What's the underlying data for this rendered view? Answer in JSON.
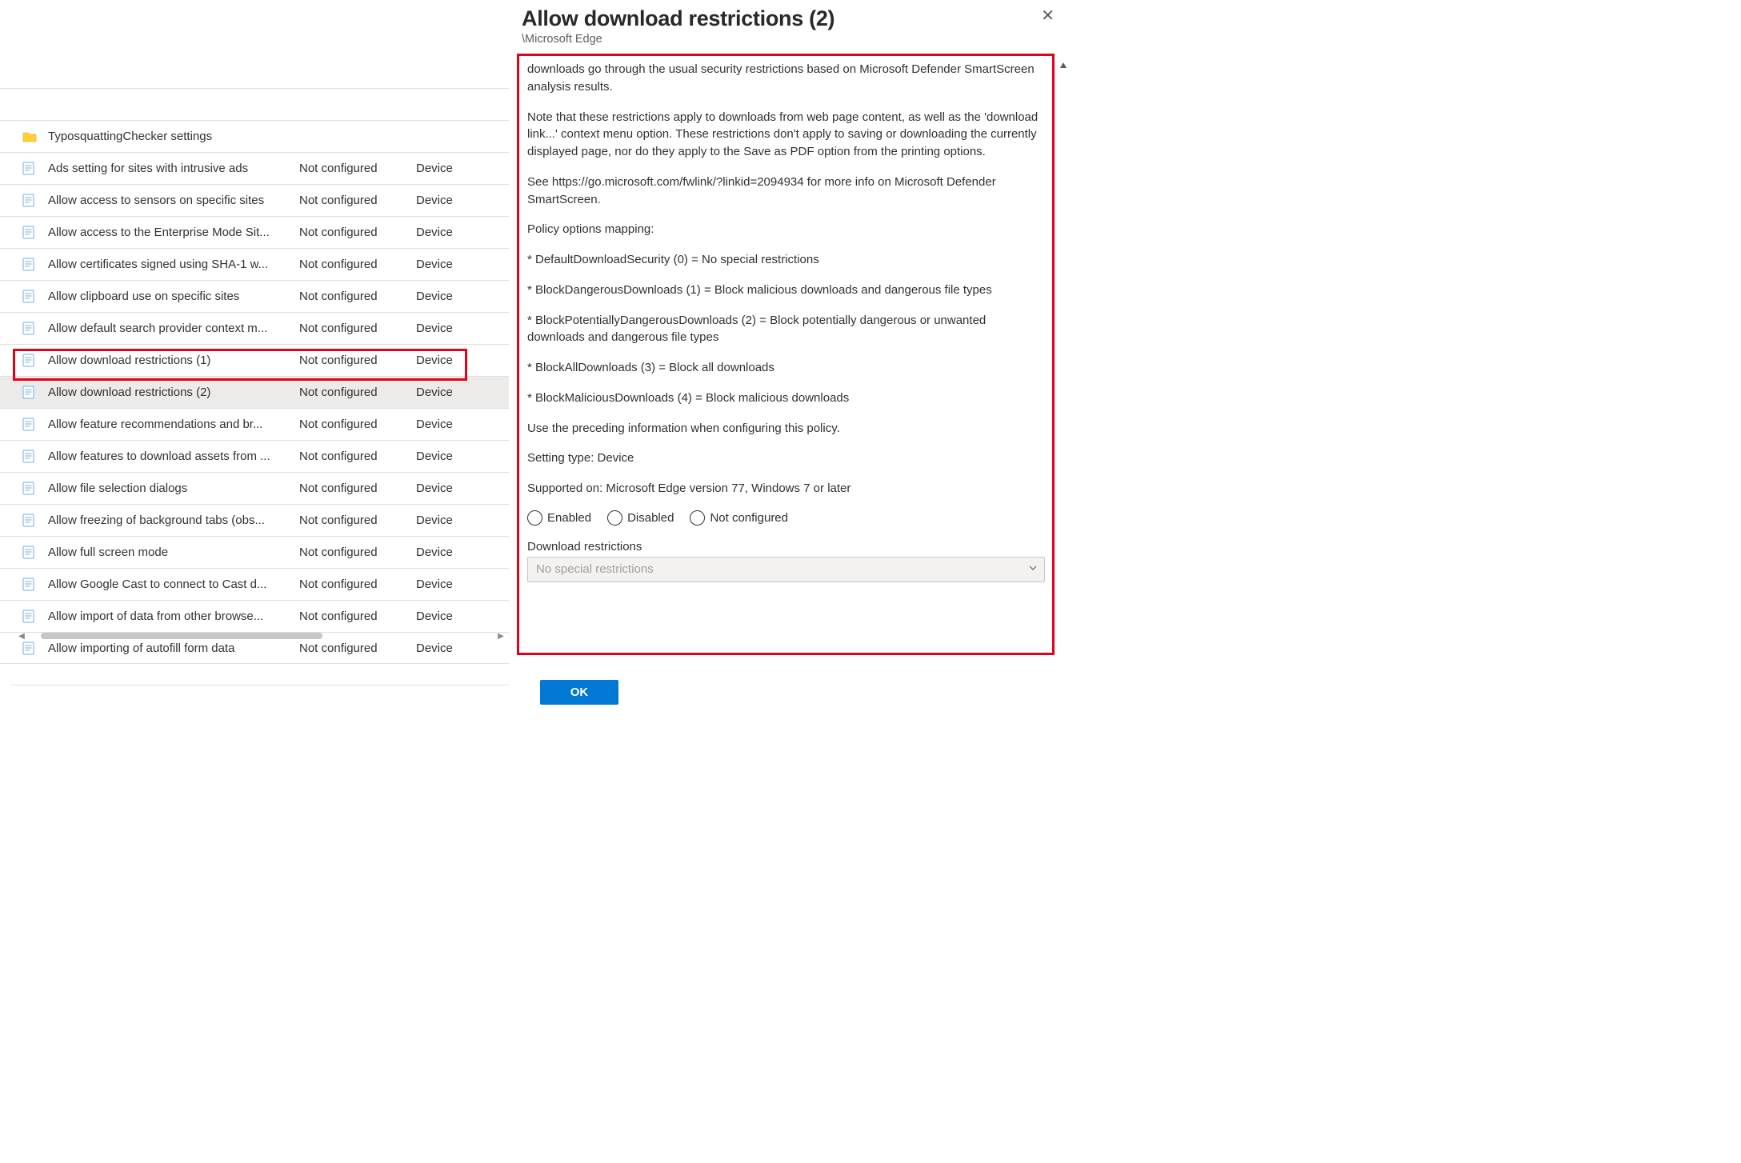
{
  "panel": {
    "title": "Allow download restrictions (2)",
    "breadcrumb": "\\Microsoft Edge",
    "description_paragraphs": [
      "downloads go through the usual security restrictions based on Microsoft Defender SmartScreen analysis results.",
      "Note that these restrictions apply to downloads from web page content, as well as the 'download link...' context menu option. These restrictions don't apply to saving or downloading the currently displayed page, nor do they apply to the Save as PDF option from the printing options.",
      "See https://go.microsoft.com/fwlink/?linkid=2094934 for more info on Microsoft Defender SmartScreen.",
      "Policy options mapping:",
      "* DefaultDownloadSecurity (0) = No special restrictions",
      "* BlockDangerousDownloads (1) = Block malicious downloads and dangerous file types",
      "* BlockPotentiallyDangerousDownloads (2) = Block potentially dangerous or unwanted downloads and dangerous file types",
      "* BlockAllDownloads (3) = Block all downloads",
      "* BlockMaliciousDownloads (4) = Block malicious downloads",
      "Use the preceding information when configuring this policy.",
      "Setting type: Device",
      "Supported on: Microsoft Edge version 77, Windows 7 or later"
    ],
    "radio_options": {
      "enabled": "Enabled",
      "disabled": "Disabled",
      "not_configured": "Not configured"
    },
    "dropdown": {
      "label": "Download restrictions",
      "value": "No special restrictions"
    },
    "ok_button": "OK"
  },
  "list": {
    "selected_index": 8,
    "rows": [
      {
        "icon": "blank",
        "name": "",
        "state": "",
        "scope": ""
      },
      {
        "icon": "folder",
        "name": "TyposquattingChecker settings",
        "state": "",
        "scope": ""
      },
      {
        "icon": "doc",
        "name": "Ads setting for sites with intrusive ads",
        "state": "Not configured",
        "scope": "Device"
      },
      {
        "icon": "doc",
        "name": "Allow access to sensors on specific sites",
        "state": "Not configured",
        "scope": "Device"
      },
      {
        "icon": "doc",
        "name": "Allow access to the Enterprise Mode Sit...",
        "state": "Not configured",
        "scope": "Device"
      },
      {
        "icon": "doc",
        "name": "Allow certificates signed using SHA-1 w...",
        "state": "Not configured",
        "scope": "Device"
      },
      {
        "icon": "doc",
        "name": "Allow clipboard use on specific sites",
        "state": "Not configured",
        "scope": "Device"
      },
      {
        "icon": "doc",
        "name": "Allow default search provider context m...",
        "state": "Not configured",
        "scope": "Device"
      },
      {
        "icon": "doc",
        "name": "Allow download restrictions (1)",
        "state": "Not configured",
        "scope": "Device"
      },
      {
        "icon": "doc",
        "name": "Allow download restrictions (2)",
        "state": "Not configured",
        "scope": "Device"
      },
      {
        "icon": "doc",
        "name": "Allow feature recommendations and br...",
        "state": "Not configured",
        "scope": "Device"
      },
      {
        "icon": "doc",
        "name": "Allow features to download assets from ...",
        "state": "Not configured",
        "scope": "Device"
      },
      {
        "icon": "doc",
        "name": "Allow file selection dialogs",
        "state": "Not configured",
        "scope": "Device"
      },
      {
        "icon": "doc",
        "name": "Allow freezing of background tabs (obs...",
        "state": "Not configured",
        "scope": "Device"
      },
      {
        "icon": "doc",
        "name": "Allow full screen mode",
        "state": "Not configured",
        "scope": "Device"
      },
      {
        "icon": "doc",
        "name": "Allow Google Cast to connect to Cast d...",
        "state": "Not configured",
        "scope": "Device"
      },
      {
        "icon": "doc",
        "name": "Allow import of data from other browse...",
        "state": "Not configured",
        "scope": "Device"
      },
      {
        "icon": "doc",
        "name": "Allow importing of autofill form data",
        "state": "Not configured",
        "scope": "Device"
      }
    ]
  }
}
